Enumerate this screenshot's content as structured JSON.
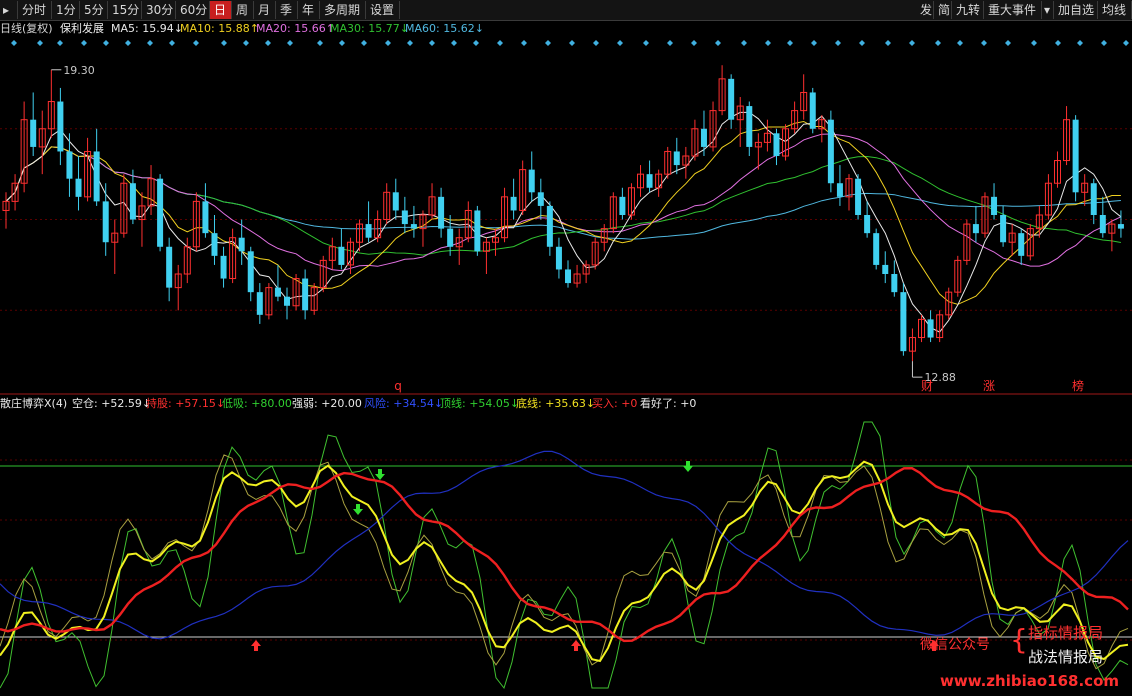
{
  "toolbar": {
    "left": [
      {
        "label": "分时",
        "active": false
      },
      {
        "label": "1分",
        "active": false
      },
      {
        "label": "5分",
        "active": false
      },
      {
        "label": "15分",
        "active": false
      },
      {
        "label": "30分",
        "active": false
      },
      {
        "label": "60分",
        "active": false
      },
      {
        "label": "日",
        "active": true
      },
      {
        "label": "周",
        "active": false
      },
      {
        "label": "月",
        "active": false
      },
      {
        "label": "季",
        "active": false
      },
      {
        "label": "年",
        "active": false
      },
      {
        "label": "多周期",
        "active": false
      },
      {
        "label": "设置",
        "active": false
      }
    ],
    "right": [
      {
        "label": "发"
      },
      {
        "label": "简"
      },
      {
        "label": "九转"
      },
      {
        "label": "重大事件"
      },
      {
        "label": "加自选"
      },
      {
        "label": "均线"
      }
    ]
  },
  "infobar": {
    "period": "日线(复权)",
    "stock": "保利发展",
    "ma": [
      {
        "label": "MA5: 15.94↓",
        "color": "#e8e8e8"
      },
      {
        "label": "MA10: 15.88↑",
        "color": "#f0d020"
      },
      {
        "label": "MA20: 15.66↑",
        "color": "#e070e0"
      },
      {
        "label": "MA30: 15.77↓",
        "color": "#30c030"
      },
      {
        "label": "MA60: 15.62↓",
        "color": "#50b8e0"
      }
    ]
  },
  "price_panel": {
    "high_label": "19.30",
    "low_label": "12.88",
    "markers": [
      {
        "text": "q",
        "color": "#ff3030"
      },
      {
        "text": "财",
        "color": "#ff3030"
      },
      {
        "text": "涨",
        "color": "#ff3030"
      },
      {
        "text": "榜",
        "color": "#ff3030"
      }
    ]
  },
  "indicator_bar": {
    "name": "散庄博弈X(4)",
    "items": [
      {
        "label": "空仓: +52.59↓",
        "color": "#e8e8e8"
      },
      {
        "label": "持股: +57.15↓",
        "color": "#ff3030"
      },
      {
        "label": "低吸: +80.00",
        "color": "#30d030"
      },
      {
        "label": "强弱: +20.00",
        "color": "#e8e8e8"
      },
      {
        "label": "风险: +34.54↓",
        "color": "#3050ff"
      },
      {
        "label": "顶线: +54.05↓",
        "color": "#30d030"
      },
      {
        "label": "底线: +35.63↓",
        "color": "#f0e020"
      },
      {
        "label": "买入: +0",
        "color": "#ff3030"
      },
      {
        "label": "看好了: +0",
        "color": "#e8e8e8"
      }
    ]
  },
  "watermark": {
    "wechat": "微信公众号",
    "line1": "指标情报局",
    "line2": "战法情报局",
    "url": "www.zhibiao168.com"
  },
  "colors": {
    "up": "#ff3030",
    "down": "#40d0f0",
    "ma5": "#e8e8e8",
    "ma10": "#f0d020",
    "ma20": "#e070e0",
    "ma30": "#30c030",
    "ma60": "#50b8e0",
    "red_line": "#ee2020",
    "yellow_line": "#f0f020",
    "green_line": "#40c030",
    "olive_line": "#a8a040",
    "blue_line": "#2030c0"
  },
  "chart_data": {
    "type": "candlestick",
    "price_high": 19.3,
    "price_low": 12.88,
    "ylim": [
      12.2,
      20.0
    ],
    "ohlc": [
      [
        16.2,
        16.6,
        15.8,
        16.4
      ],
      [
        16.4,
        17.0,
        16.2,
        16.8
      ],
      [
        16.8,
        18.6,
        16.6,
        18.2
      ],
      [
        18.2,
        18.8,
        17.4,
        17.6
      ],
      [
        17.6,
        18.4,
        17.0,
        18.0
      ],
      [
        18.0,
        19.3,
        17.8,
        18.6
      ],
      [
        18.6,
        18.9,
        17.2,
        17.5
      ],
      [
        17.5,
        17.9,
        16.5,
        16.9
      ],
      [
        16.9,
        17.4,
        16.2,
        16.5
      ],
      [
        16.5,
        17.8,
        16.4,
        17.5
      ],
      [
        17.5,
        18.0,
        16.3,
        16.4
      ],
      [
        16.4,
        16.8,
        15.2,
        15.5
      ],
      [
        15.5,
        16.0,
        14.8,
        15.7
      ],
      [
        15.7,
        17.0,
        15.6,
        16.8
      ],
      [
        16.8,
        17.1,
        15.9,
        16.0
      ],
      [
        16.0,
        16.6,
        15.4,
        16.3
      ],
      [
        16.3,
        17.2,
        16.1,
        16.9
      ],
      [
        16.9,
        17.0,
        15.3,
        15.4
      ],
      [
        15.4,
        15.6,
        14.2,
        14.5
      ],
      [
        14.5,
        15.0,
        14.0,
        14.8
      ],
      [
        14.8,
        15.6,
        14.6,
        15.4
      ],
      [
        15.4,
        16.6,
        15.3,
        16.4
      ],
      [
        16.4,
        16.8,
        15.6,
        15.7
      ],
      [
        15.7,
        16.1,
        15.0,
        15.2
      ],
      [
        15.2,
        15.4,
        14.5,
        14.7
      ],
      [
        14.7,
        15.8,
        14.6,
        15.6
      ],
      [
        15.6,
        16.0,
        15.0,
        15.3
      ],
      [
        15.3,
        15.4,
        14.2,
        14.4
      ],
      [
        14.4,
        14.6,
        13.7,
        13.9
      ],
      [
        13.9,
        14.6,
        13.8,
        14.5
      ],
      [
        14.5,
        15.0,
        14.2,
        14.3
      ],
      [
        14.3,
        14.5,
        13.8,
        14.1
      ],
      [
        14.1,
        14.8,
        14.0,
        14.7
      ],
      [
        14.7,
        14.9,
        13.8,
        14.0
      ],
      [
        14.0,
        14.6,
        13.9,
        14.5
      ],
      [
        14.5,
        15.2,
        14.4,
        15.1
      ],
      [
        15.1,
        15.6,
        14.9,
        15.4
      ],
      [
        15.4,
        15.8,
        14.9,
        15.0
      ],
      [
        15.0,
        15.6,
        14.8,
        15.5
      ],
      [
        15.5,
        16.0,
        15.3,
        15.9
      ],
      [
        15.9,
        16.4,
        15.5,
        15.6
      ],
      [
        15.6,
        16.2,
        15.5,
        16.0
      ],
      [
        16.0,
        16.8,
        15.9,
        16.6
      ],
      [
        16.6,
        16.9,
        16.0,
        16.2
      ],
      [
        16.2,
        16.5,
        15.7,
        15.9
      ],
      [
        15.9,
        16.3,
        15.6,
        15.8
      ],
      [
        15.8,
        16.2,
        15.4,
        16.1
      ],
      [
        16.1,
        16.8,
        16.0,
        16.5
      ],
      [
        16.5,
        16.7,
        15.6,
        15.8
      ],
      [
        15.8,
        16.1,
        15.2,
        15.4
      ],
      [
        15.4,
        15.8,
        15.0,
        15.6
      ],
      [
        15.6,
        16.4,
        15.5,
        16.2
      ],
      [
        16.2,
        16.3,
        15.2,
        15.3
      ],
      [
        15.3,
        15.6,
        14.8,
        15.5
      ],
      [
        15.5,
        15.8,
        15.2,
        15.6
      ],
      [
        15.6,
        16.7,
        15.5,
        16.5
      ],
      [
        16.5,
        16.9,
        16.0,
        16.2
      ],
      [
        16.2,
        17.3,
        16.1,
        17.1
      ],
      [
        17.1,
        17.5,
        16.4,
        16.6
      ],
      [
        16.6,
        16.9,
        16.0,
        16.3
      ],
      [
        16.3,
        16.4,
        15.2,
        15.4
      ],
      [
        15.4,
        15.6,
        14.7,
        14.9
      ],
      [
        14.9,
        15.1,
        14.5,
        14.6
      ],
      [
        14.6,
        15.0,
        14.5,
        14.8
      ],
      [
        14.8,
        15.1,
        14.6,
        15.0
      ],
      [
        15.0,
        15.6,
        14.9,
        15.5
      ],
      [
        15.5,
        15.9,
        15.3,
        15.8
      ],
      [
        15.8,
        16.6,
        15.7,
        16.5
      ],
      [
        16.5,
        16.7,
        16.0,
        16.1
      ],
      [
        16.1,
        16.8,
        16.0,
        16.7
      ],
      [
        16.7,
        17.2,
        16.5,
        17.0
      ],
      [
        17.0,
        17.3,
        16.6,
        16.7
      ],
      [
        16.7,
        17.1,
        16.5,
        17.0
      ],
      [
        17.0,
        17.6,
        16.9,
        17.5
      ],
      [
        17.5,
        17.8,
        17.0,
        17.2
      ],
      [
        17.2,
        17.6,
        16.9,
        17.4
      ],
      [
        17.4,
        18.2,
        17.3,
        18.0
      ],
      [
        18.0,
        18.4,
        17.4,
        17.6
      ],
      [
        17.6,
        18.6,
        17.5,
        18.4
      ],
      [
        18.4,
        19.4,
        18.3,
        19.1
      ],
      [
        19.1,
        19.2,
        18.0,
        18.2
      ],
      [
        18.2,
        18.7,
        17.6,
        18.5
      ],
      [
        18.5,
        18.6,
        17.4,
        17.6
      ],
      [
        17.6,
        17.9,
        17.1,
        17.7
      ],
      [
        17.7,
        18.2,
        17.5,
        17.9
      ],
      [
        17.9,
        18.0,
        17.2,
        17.4
      ],
      [
        17.4,
        18.1,
        17.3,
        18.0
      ],
      [
        18.0,
        18.6,
        17.9,
        18.4
      ],
      [
        18.4,
        19.2,
        18.2,
        18.8
      ],
      [
        18.8,
        18.9,
        17.9,
        18.0
      ],
      [
        18.0,
        18.3,
        17.7,
        18.2
      ],
      [
        18.2,
        18.4,
        16.6,
        16.8
      ],
      [
        16.8,
        17.2,
        16.3,
        16.5
      ],
      [
        16.5,
        17.0,
        16.2,
        16.9
      ],
      [
        16.9,
        17.0,
        16.0,
        16.1
      ],
      [
        16.1,
        16.4,
        15.6,
        15.7
      ],
      [
        15.7,
        15.8,
        14.9,
        15.0
      ],
      [
        15.0,
        15.3,
        14.6,
        14.8
      ],
      [
        14.8,
        15.1,
        14.3,
        14.4
      ],
      [
        14.4,
        14.6,
        13.0,
        13.1
      ],
      [
        13.1,
        13.6,
        12.88,
        13.4
      ],
      [
        13.4,
        13.9,
        13.3,
        13.8
      ],
      [
        13.8,
        14.0,
        13.3,
        13.4
      ],
      [
        13.4,
        14.0,
        13.3,
        13.9
      ],
      [
        13.9,
        14.5,
        13.8,
        14.4
      ],
      [
        14.4,
        15.2,
        14.3,
        15.1
      ],
      [
        15.1,
        16.0,
        15.0,
        15.9
      ],
      [
        15.9,
        16.3,
        15.5,
        15.7
      ],
      [
        15.7,
        16.6,
        15.6,
        16.5
      ],
      [
        16.5,
        16.8,
        16.0,
        16.1
      ],
      [
        16.1,
        16.3,
        15.4,
        15.5
      ],
      [
        15.5,
        15.9,
        15.2,
        15.7
      ],
      [
        15.7,
        15.8,
        15.0,
        15.2
      ],
      [
        15.2,
        15.9,
        15.1,
        15.8
      ],
      [
        15.8,
        16.3,
        15.6,
        16.1
      ],
      [
        16.1,
        17.0,
        16.0,
        16.8
      ],
      [
        16.8,
        17.5,
        16.7,
        17.3
      ],
      [
        17.3,
        18.5,
        17.2,
        18.2
      ],
      [
        18.2,
        18.3,
        16.4,
        16.6
      ],
      [
        16.6,
        17.0,
        16.3,
        16.8
      ],
      [
        16.8,
        16.9,
        15.9,
        16.1
      ],
      [
        16.1,
        16.5,
        15.6,
        15.7
      ],
      [
        15.7,
        16.0,
        15.3,
        15.9
      ],
      [
        15.9,
        16.2,
        15.6,
        15.8
      ]
    ]
  }
}
